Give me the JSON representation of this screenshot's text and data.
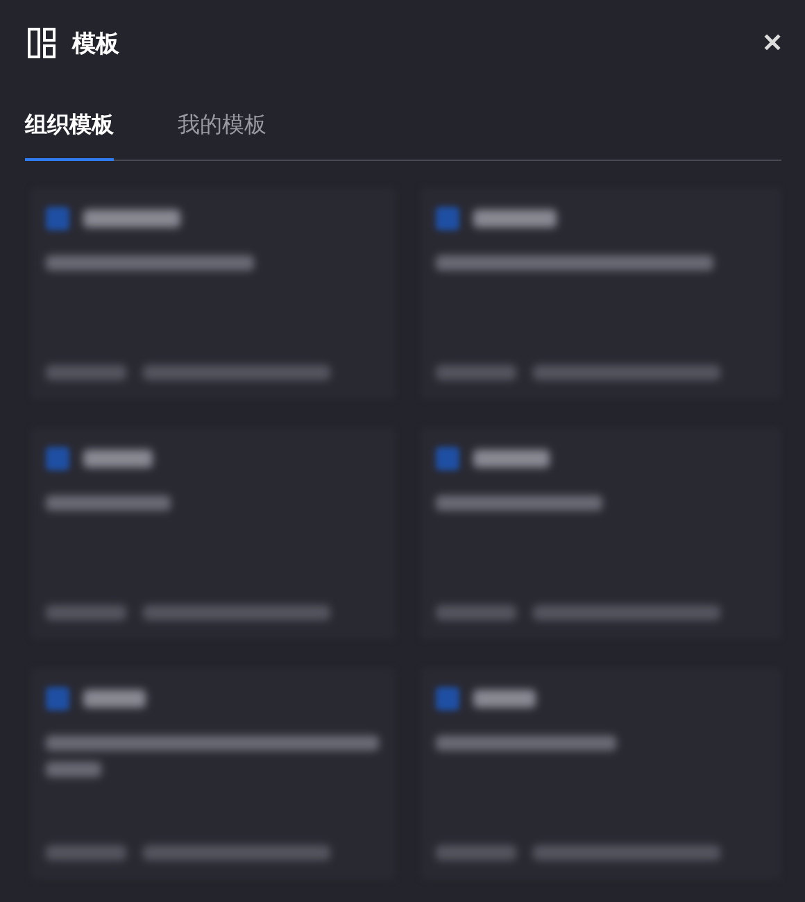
{
  "dialog": {
    "title": "模板",
    "close": "✕"
  },
  "tabs": [
    {
      "label": "组织模板",
      "selected": true
    },
    {
      "label": "我的模板",
      "selected": false
    }
  ],
  "cards": [
    {
      "kind": "one-line"
    },
    {
      "kind": "one-line"
    },
    {
      "kind": "one-line"
    },
    {
      "kind": "one-line"
    },
    {
      "kind": "two-line"
    },
    {
      "kind": "one-line"
    }
  ]
}
